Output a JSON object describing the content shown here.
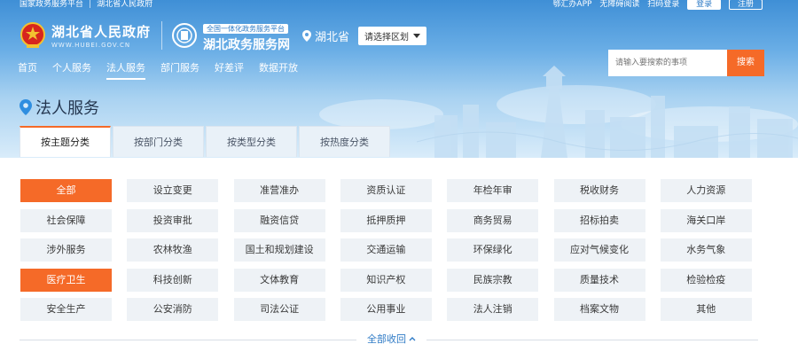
{
  "topbar": {
    "links": [
      "国家政务服务平台",
      "湖北省人民政府"
    ],
    "right": [
      "鄂汇办APP",
      "无障碍阅读",
      "扫码登录"
    ],
    "login": "登录",
    "register": "注册"
  },
  "logo": {
    "gov_title": "湖北省人民政府",
    "gov_domain": "WWW.HUBEI.GOV.CN",
    "platform_badge": "全国一体化政务服务平台",
    "platform_title": "湖北政务服务网"
  },
  "region": {
    "current": "湖北省",
    "select_label": "请选择区划"
  },
  "nav": {
    "items": [
      "首页",
      "个人服务",
      "法人服务",
      "部门服务",
      "好差评",
      "数据开放"
    ],
    "active": "法人服务"
  },
  "search": {
    "placeholder": "请输入要搜索的事项",
    "button": "搜索"
  },
  "page_title": "法人服务",
  "tabs": [
    "按主题分类",
    "按部门分类",
    "按类型分类",
    "按热度分类"
  ],
  "active_tab": "按主题分类",
  "categories": [
    "全部",
    "设立变更",
    "准营准办",
    "资质认证",
    "年检年审",
    "税收财务",
    "人力资源",
    "社会保障",
    "投资审批",
    "融资信贷",
    "抵押质押",
    "商务贸易",
    "招标拍卖",
    "海关口岸",
    "涉外服务",
    "农林牧渔",
    "国土和规划建设",
    "交通运输",
    "环保绿化",
    "应对气候变化",
    "水务气象",
    "医疗卫生",
    "科技创新",
    "文体教育",
    "知识产权",
    "民族宗教",
    "质量技术",
    "检验检疫",
    "安全生产",
    "公安消防",
    "司法公证",
    "公用事业",
    "法人注销",
    "档案文物",
    "其他"
  ],
  "highlighted_categories": [
    "全部",
    "医疗卫生"
  ],
  "collapse_label": "全部收回",
  "colors": {
    "accent": "#f56a28",
    "primary": "#2f7bc6",
    "chip_bg": "#eef2f6"
  }
}
